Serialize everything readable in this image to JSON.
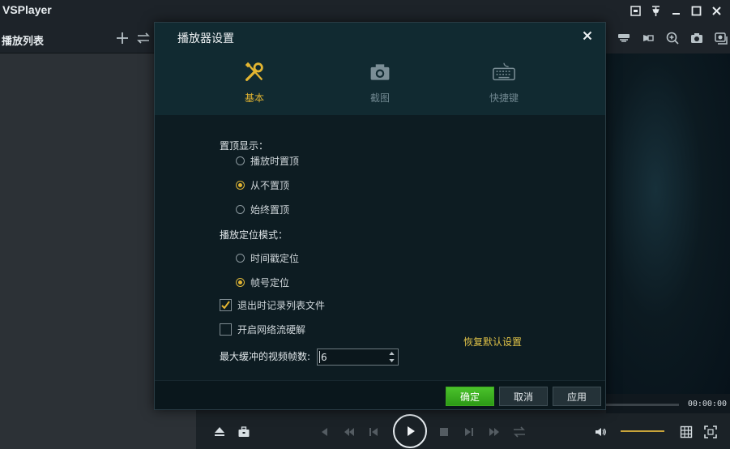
{
  "app": {
    "title": "VSPlayer"
  },
  "playlist": {
    "title": "播放列表"
  },
  "player": {
    "time": "00:00:00"
  },
  "dialog": {
    "title": "播放器设置",
    "tabs": [
      {
        "label": "基本",
        "icon": "tools-icon",
        "active": true
      },
      {
        "label": "截图",
        "icon": "camera-icon",
        "active": false
      },
      {
        "label": "快捷键",
        "icon": "keyboard-icon",
        "active": false
      }
    ],
    "topmost": {
      "label": "置顶显示：",
      "options": [
        {
          "label": "播放时置顶",
          "checked": false
        },
        {
          "label": "从不置顶",
          "checked": true
        },
        {
          "label": "始终置顶",
          "checked": false
        }
      ]
    },
    "seek_mode": {
      "label": "播放定位模式：",
      "options": [
        {
          "label": "时间戳定位",
          "checked": false
        },
        {
          "label": "帧号定位",
          "checked": true
        }
      ]
    },
    "checkboxes": [
      {
        "label": "退出时记录列表文件",
        "checked": true
      },
      {
        "label": "开启网络流硬解",
        "checked": false
      }
    ],
    "restore_label": "恢复默认设置",
    "buffer": {
      "label": "最大缓冲的视频帧数:",
      "value": "6"
    },
    "buttons": {
      "ok": "确定",
      "cancel": "取消",
      "apply": "应用"
    }
  },
  "colors": {
    "accent": "#e3b531",
    "primary_button": "#3aa81f"
  }
}
